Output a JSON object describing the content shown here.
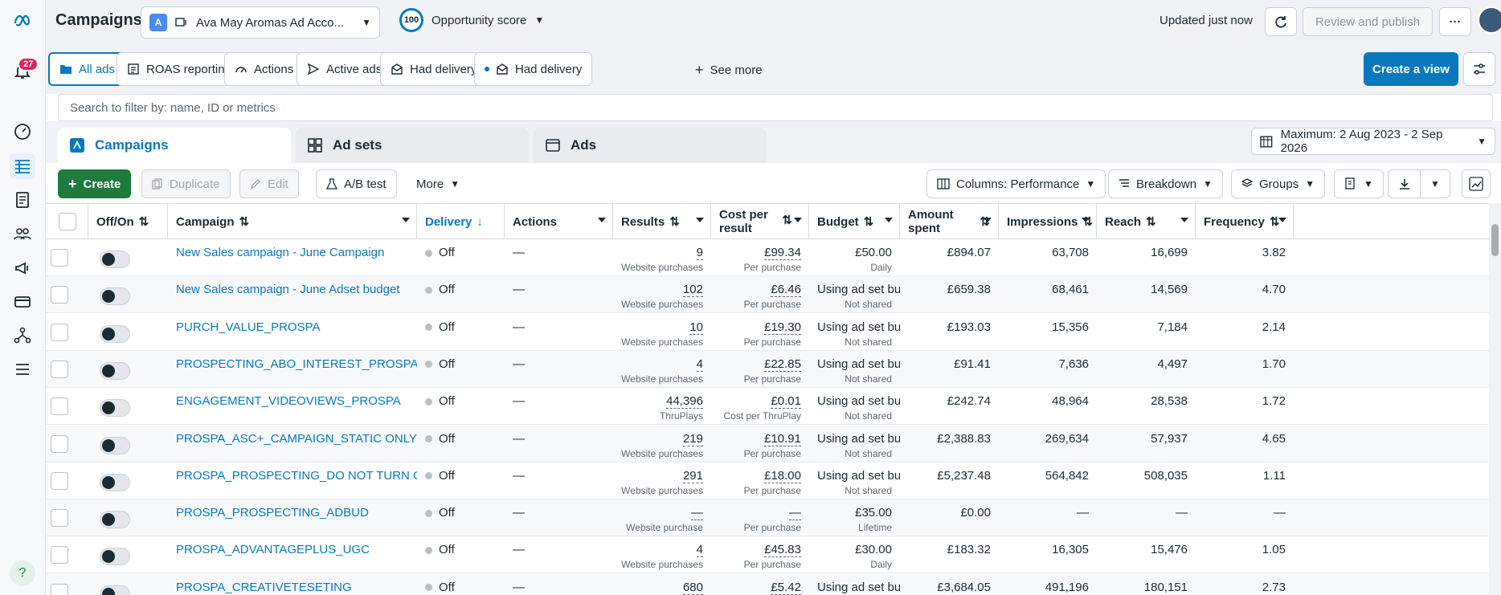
{
  "app": {
    "title": "Campaigns",
    "notif_count": "27"
  },
  "account": {
    "avatar_letter": "A",
    "name": "Ava May Aromas Ad Acco..."
  },
  "score": {
    "value": "100",
    "label": "Opportunity score"
  },
  "header": {
    "updated": "Updated just now",
    "review_publish": "Review and publish",
    "more": "···"
  },
  "views": {
    "items": [
      {
        "label": "All ads",
        "icon": "folder-icon"
      },
      {
        "label": "ROAS reporting",
        "icon": "report-icon"
      },
      {
        "label": "Actions",
        "icon": "gauge-icon"
      },
      {
        "label": "Active ads",
        "icon": "send-icon"
      },
      {
        "label": "Had delivery",
        "icon": "mail-icon"
      },
      {
        "label": "Had delivery",
        "icon": "mail-icon"
      }
    ],
    "see_more": "See more",
    "create_view": "Create a view"
  },
  "search": {
    "placeholder": "Search to filter by: name, ID or metrics"
  },
  "tabs": {
    "campaigns": "Campaigns",
    "adsets": "Ad sets",
    "ads": "Ads"
  },
  "daterange": "Maximum: 2 Aug 2023 - 2 Sep 2026",
  "toolbar": {
    "create": "Create",
    "duplicate": "Duplicate",
    "edit": "Edit",
    "abtest": "A/B test",
    "more": "More",
    "columns": "Columns: Performance",
    "breakdown": "Breakdown",
    "groups": "Groups"
  },
  "columns": {
    "offon": "Off/On",
    "campaign": "Campaign",
    "delivery": "Delivery",
    "actions": "Actions",
    "results": "Results",
    "cpr1": "Cost per",
    "cpr2": "result",
    "budget": "Budget",
    "amount": "Amount spent",
    "impressions": "Impressions",
    "reach": "Reach",
    "frequency": "Frequency"
  },
  "rows": [
    {
      "name": "New Sales campaign - June Campaign",
      "delivery": "Off",
      "actions": "—",
      "results": "9",
      "results_sub": "Website purchases",
      "cpr": "£99.34",
      "cpr_sub": "Per purchase",
      "budget": "£50.00",
      "budget_sub": "Daily",
      "amount": "£894.07",
      "impressions": "63,708",
      "reach": "16,699",
      "frequency": "3.82"
    },
    {
      "name": "New Sales campaign - June Adset budget",
      "delivery": "Off",
      "actions": "—",
      "results": "102",
      "results_sub": "Website purchases",
      "cpr": "£6.46",
      "cpr_sub": "Per purchase",
      "budget": "Using ad set bu...",
      "budget_sub": "Not shared",
      "amount": "£659.38",
      "impressions": "68,461",
      "reach": "14,569",
      "frequency": "4.70"
    },
    {
      "name": "PURCH_VALUE_PROSPA",
      "delivery": "Off",
      "actions": "—",
      "results": "10",
      "results_sub": "Website purchases",
      "cpr": "£19.30",
      "cpr_sub": "Per purchase",
      "budget": "Using ad set bu...",
      "budget_sub": "Not shared",
      "amount": "£193.03",
      "impressions": "15,356",
      "reach": "7,184",
      "frequency": "2.14"
    },
    {
      "name": "PROSPECTING_ABO_INTEREST_PROSPA",
      "delivery": "Off",
      "actions": "—",
      "results": "4",
      "results_sub": "Website purchases",
      "cpr": "£22.85",
      "cpr_sub": "Per purchase",
      "budget": "Using ad set bu...",
      "budget_sub": "Not shared",
      "amount": "£91.41",
      "impressions": "7,636",
      "reach": "4,497",
      "frequency": "1.70"
    },
    {
      "name": "ENGAGEMENT_VIDEOVIEWS_PROSPA",
      "delivery": "Off",
      "actions": "—",
      "results": "44,396",
      "results_sub": "ThruPlays",
      "cpr": "£0.01",
      "cpr_sub": "Cost per ThruPlay",
      "budget": "Using ad set bu...",
      "budget_sub": "Not shared",
      "amount": "£242.74",
      "impressions": "48,964",
      "reach": "28,538",
      "frequency": "1.72"
    },
    {
      "name": "PROSPA_ASC+_CAMPAIGN_STATIC ONLY",
      "delivery": "Off",
      "actions": "—",
      "results": "219",
      "results_sub": "Website purchases",
      "cpr": "£10.91",
      "cpr_sub": "Per purchase",
      "budget": "Using ad set bu...",
      "budget_sub": "Not shared",
      "amount": "£2,388.83",
      "impressions": "269,634",
      "reach": "57,937",
      "frequency": "4.65"
    },
    {
      "name": "PROSPA_PROSPECTING_DO NOT TURN ON H...",
      "delivery": "Off",
      "actions": "—",
      "results": "291",
      "results_sub": "Website purchases",
      "cpr": "£18.00",
      "cpr_sub": "Per purchase",
      "budget": "Using ad set bu...",
      "budget_sub": "Not shared",
      "amount": "£5,237.48",
      "impressions": "564,842",
      "reach": "508,035",
      "frequency": "1.11"
    },
    {
      "name": "PROSPA_PROSPECTING_ADBUD",
      "delivery": "Off",
      "actions": "—",
      "results": "—",
      "results_sub": "Website purchase",
      "cpr": "—",
      "cpr_sub": "Per purchase",
      "budget": "£35.00",
      "budget_sub": "Lifetime",
      "amount": "£0.00",
      "impressions": "—",
      "reach": "—",
      "frequency": "—"
    },
    {
      "name": "PROSPA_ADVANTAGEPLUS_UGC",
      "delivery": "Off",
      "actions": "—",
      "results": "4",
      "results_sub": "Website purchases",
      "cpr": "£45.83",
      "cpr_sub": "Per purchase",
      "budget": "£30.00",
      "budget_sub": "Daily",
      "amount": "£183.32",
      "impressions": "16,305",
      "reach": "15,476",
      "frequency": "1.05"
    },
    {
      "name": "PROSPA_CREATIVETESETING",
      "delivery": "Off",
      "actions": "—",
      "results": "680",
      "results_sub": "",
      "cpr": "£5.42",
      "cpr_sub": "",
      "budget": "Using ad set bu...",
      "budget_sub": "",
      "amount": "£3,684.05",
      "impressions": "491,196",
      "reach": "180,151",
      "frequency": "2.73"
    }
  ],
  "colors": {
    "brand_blue": "#0a78be",
    "create_green": "#1e7a3d",
    "notif_red": "#e0245e"
  }
}
